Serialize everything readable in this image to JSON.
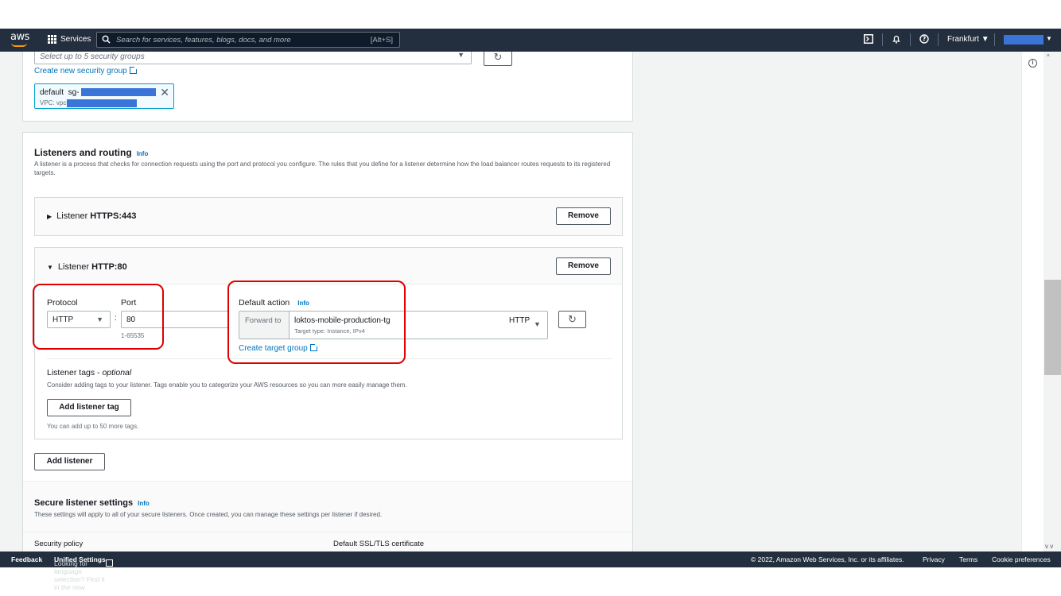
{
  "nav": {
    "logo": "aws",
    "services_label": "Services",
    "search_placeholder": "Search for services, features, blogs, docs, and more",
    "search_shortcut": "[Alt+S]",
    "region": "Frankfurt"
  },
  "security_groups": {
    "select_placeholder": "Select up to 5 security groups",
    "create_link": "Create new security group",
    "token_name": "default",
    "token_sg_prefix": "sg-",
    "token_vpc_prefix": "VPC: vpc-"
  },
  "listeners": {
    "title": "Listeners and routing",
    "info": "Info",
    "description": "A listener is a process that checks for connection requests using the port and protocol you configure. The rules that you define for a listener determine how the load balancer routes requests to its registered targets.",
    "https_listener": {
      "label": "Listener",
      "name": "HTTPS:443",
      "remove": "Remove"
    },
    "http_listener": {
      "label": "Listener",
      "name": "HTTP:80",
      "remove": "Remove",
      "protocol_label": "Protocol",
      "protocol_value": "HTTP",
      "colon": ":",
      "port_label": "Port",
      "port_value": "80",
      "port_hint": "1-65535",
      "default_action_label": "Default action",
      "default_action_info": "Info",
      "forward_to": "Forward to",
      "target_group": "loktos-mobile-production-tg",
      "target_type": "Target type: Instance, IPv4",
      "target_protocol": "HTTP",
      "create_target_group": "Create target group",
      "tags_title": "Listener tags - ",
      "tags_optional": "optional",
      "tags_description": "Consider adding tags to your listener. Tags enable you to categorize your AWS resources so you can more easily manage them.",
      "add_tag": "Add listener tag",
      "tags_hint": "You can add up to 50 more tags."
    },
    "add_listener": "Add listener"
  },
  "secure_settings": {
    "title": "Secure listener settings",
    "info": "Info",
    "description": "These settings will apply to all of your secure listeners. Once created, you can manage these settings per listener if desired.",
    "security_policy_label": "Security policy",
    "ssl_label": "Default SSL/TLS certificate"
  },
  "footer": {
    "feedback": "Feedback",
    "language_text": "Looking for language selection? Find it in the new",
    "unified_settings": "Unified Settings",
    "copyright": "© 2022, Amazon Web Services, Inc. or its affiliates.",
    "privacy": "Privacy",
    "terms": "Terms",
    "cookie": "Cookie preferences"
  },
  "colors": {
    "nav_bg": "#232f3e",
    "link": "#0073bb",
    "highlight": "#e00000",
    "redaction": "#3a74d8"
  }
}
